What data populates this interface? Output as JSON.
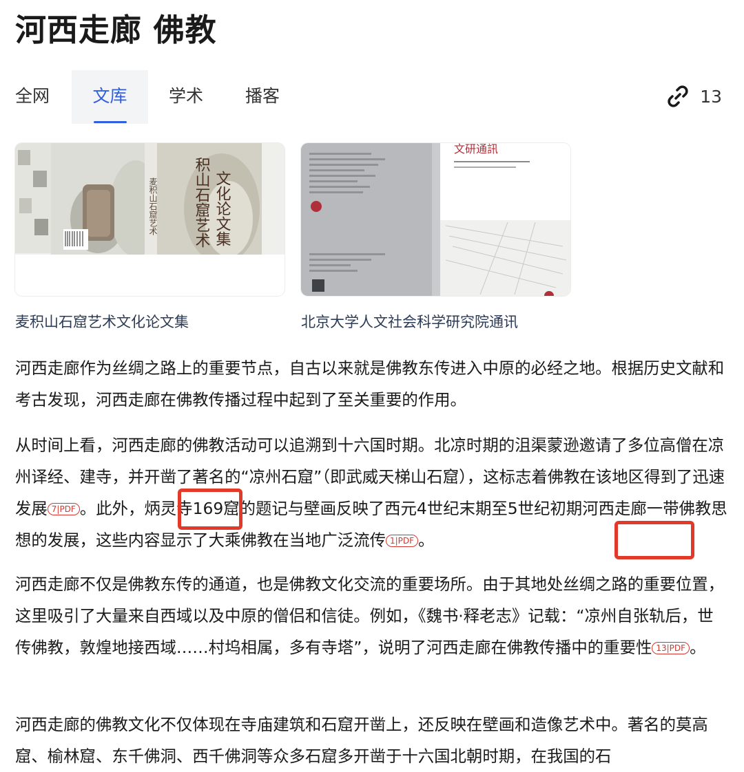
{
  "query_title": "河西走廊 佛教",
  "tabs": [
    {
      "label": "全网"
    },
    {
      "label": "文库"
    },
    {
      "label": "学术"
    },
    {
      "label": "播客"
    }
  ],
  "active_tab": "文库",
  "link_count": "13",
  "cards": [
    {
      "caption": "麦积山石窟艺术文化论文集",
      "cover_text": "麦积山石窟艺术文化论文集"
    },
    {
      "caption": "北京大学人文社会科学研究院通讯",
      "cover_text": "文研通訊"
    }
  ],
  "paragraphs": {
    "p1": "河西走廊作为丝绸之路上的重要节点，自古以来就是佛教东传进入中原的必经之地。根据历史文献和考古发现，河西走廊在佛教传播过程中起到了至关重要的作用。",
    "p2_a": "从时间上看，河西走廊的佛教活动可以追溯到十六国时期。北凉时期的沮渠蒙逊邀请了多位高僧在凉州译经、建寺，并开凿了著名的“凉州石窟”（即武威天梯山石窟），这标志着佛教在该地区得到了迅速发展",
    "p2_cite1": "7|PDF",
    "p2_b": "。此外，炳灵寺169窟的题记与壁画反映了西元4世纪末期至5世纪初期河西走廊一带佛教思想的发展，这些内容显示了大乘佛教在当地广泛流传",
    "p2_cite2": "1|PDF",
    "p2_c": "。",
    "p3_a": "河西走廊不仅是佛教东传的通道，也是佛教文化交流的重要场所。由于其地处丝绸之路的重要位置，这里吸引了大量来自西域以及中原的僧侣和信徒。例如，《魏书·释老志》记载：“凉州自张轨后，世传佛教，敦煌地接西域……村坞相属，多有寺塔”，说明了河西走廊在佛教传播中的重要性",
    "p3_cite": "13|PDF",
    "p3_b": "。",
    "p4": "河西走廊的佛教文化不仅体现在寺庙建筑和石窟开凿上，还反映在壁画和造像艺术中。著名的莫高窟、榆林窟、东千佛洞、西千佛洞等众多石窟多开凿于十六国北朝时期，在我国的石"
  },
  "colors": {
    "accent": "#2f5fde",
    "citation": "#d9362b",
    "highlight": "#e23a2a"
  }
}
